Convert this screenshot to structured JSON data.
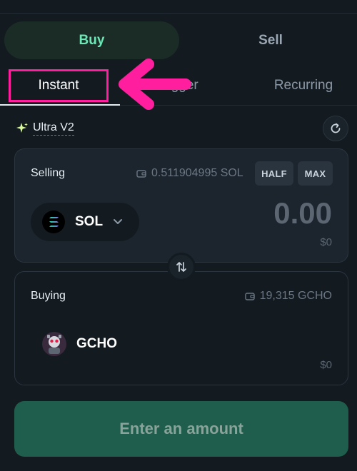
{
  "side_tabs": {
    "buy": "Buy",
    "sell": "Sell"
  },
  "order_tabs": {
    "instant": "Instant",
    "trigger": "Trigger",
    "recurring": "Recurring"
  },
  "mode": {
    "label": "Ultra V2",
    "icon": "sparkle-icon"
  },
  "selling": {
    "label": "Selling",
    "balance": "0.511904995 SOL",
    "half_label": "HALF",
    "max_label": "MAX",
    "token": "SOL",
    "amount": "0.00",
    "usd": "$0"
  },
  "buying": {
    "label": "Buying",
    "balance": "19,315 GCHO",
    "token": "GCHO",
    "usd": "$0"
  },
  "cta_label": "Enter an amount",
  "colors": {
    "accent": "#6ee7b7",
    "highlight": "#ff1f9e",
    "cta_bg": "#1f5e4c"
  }
}
